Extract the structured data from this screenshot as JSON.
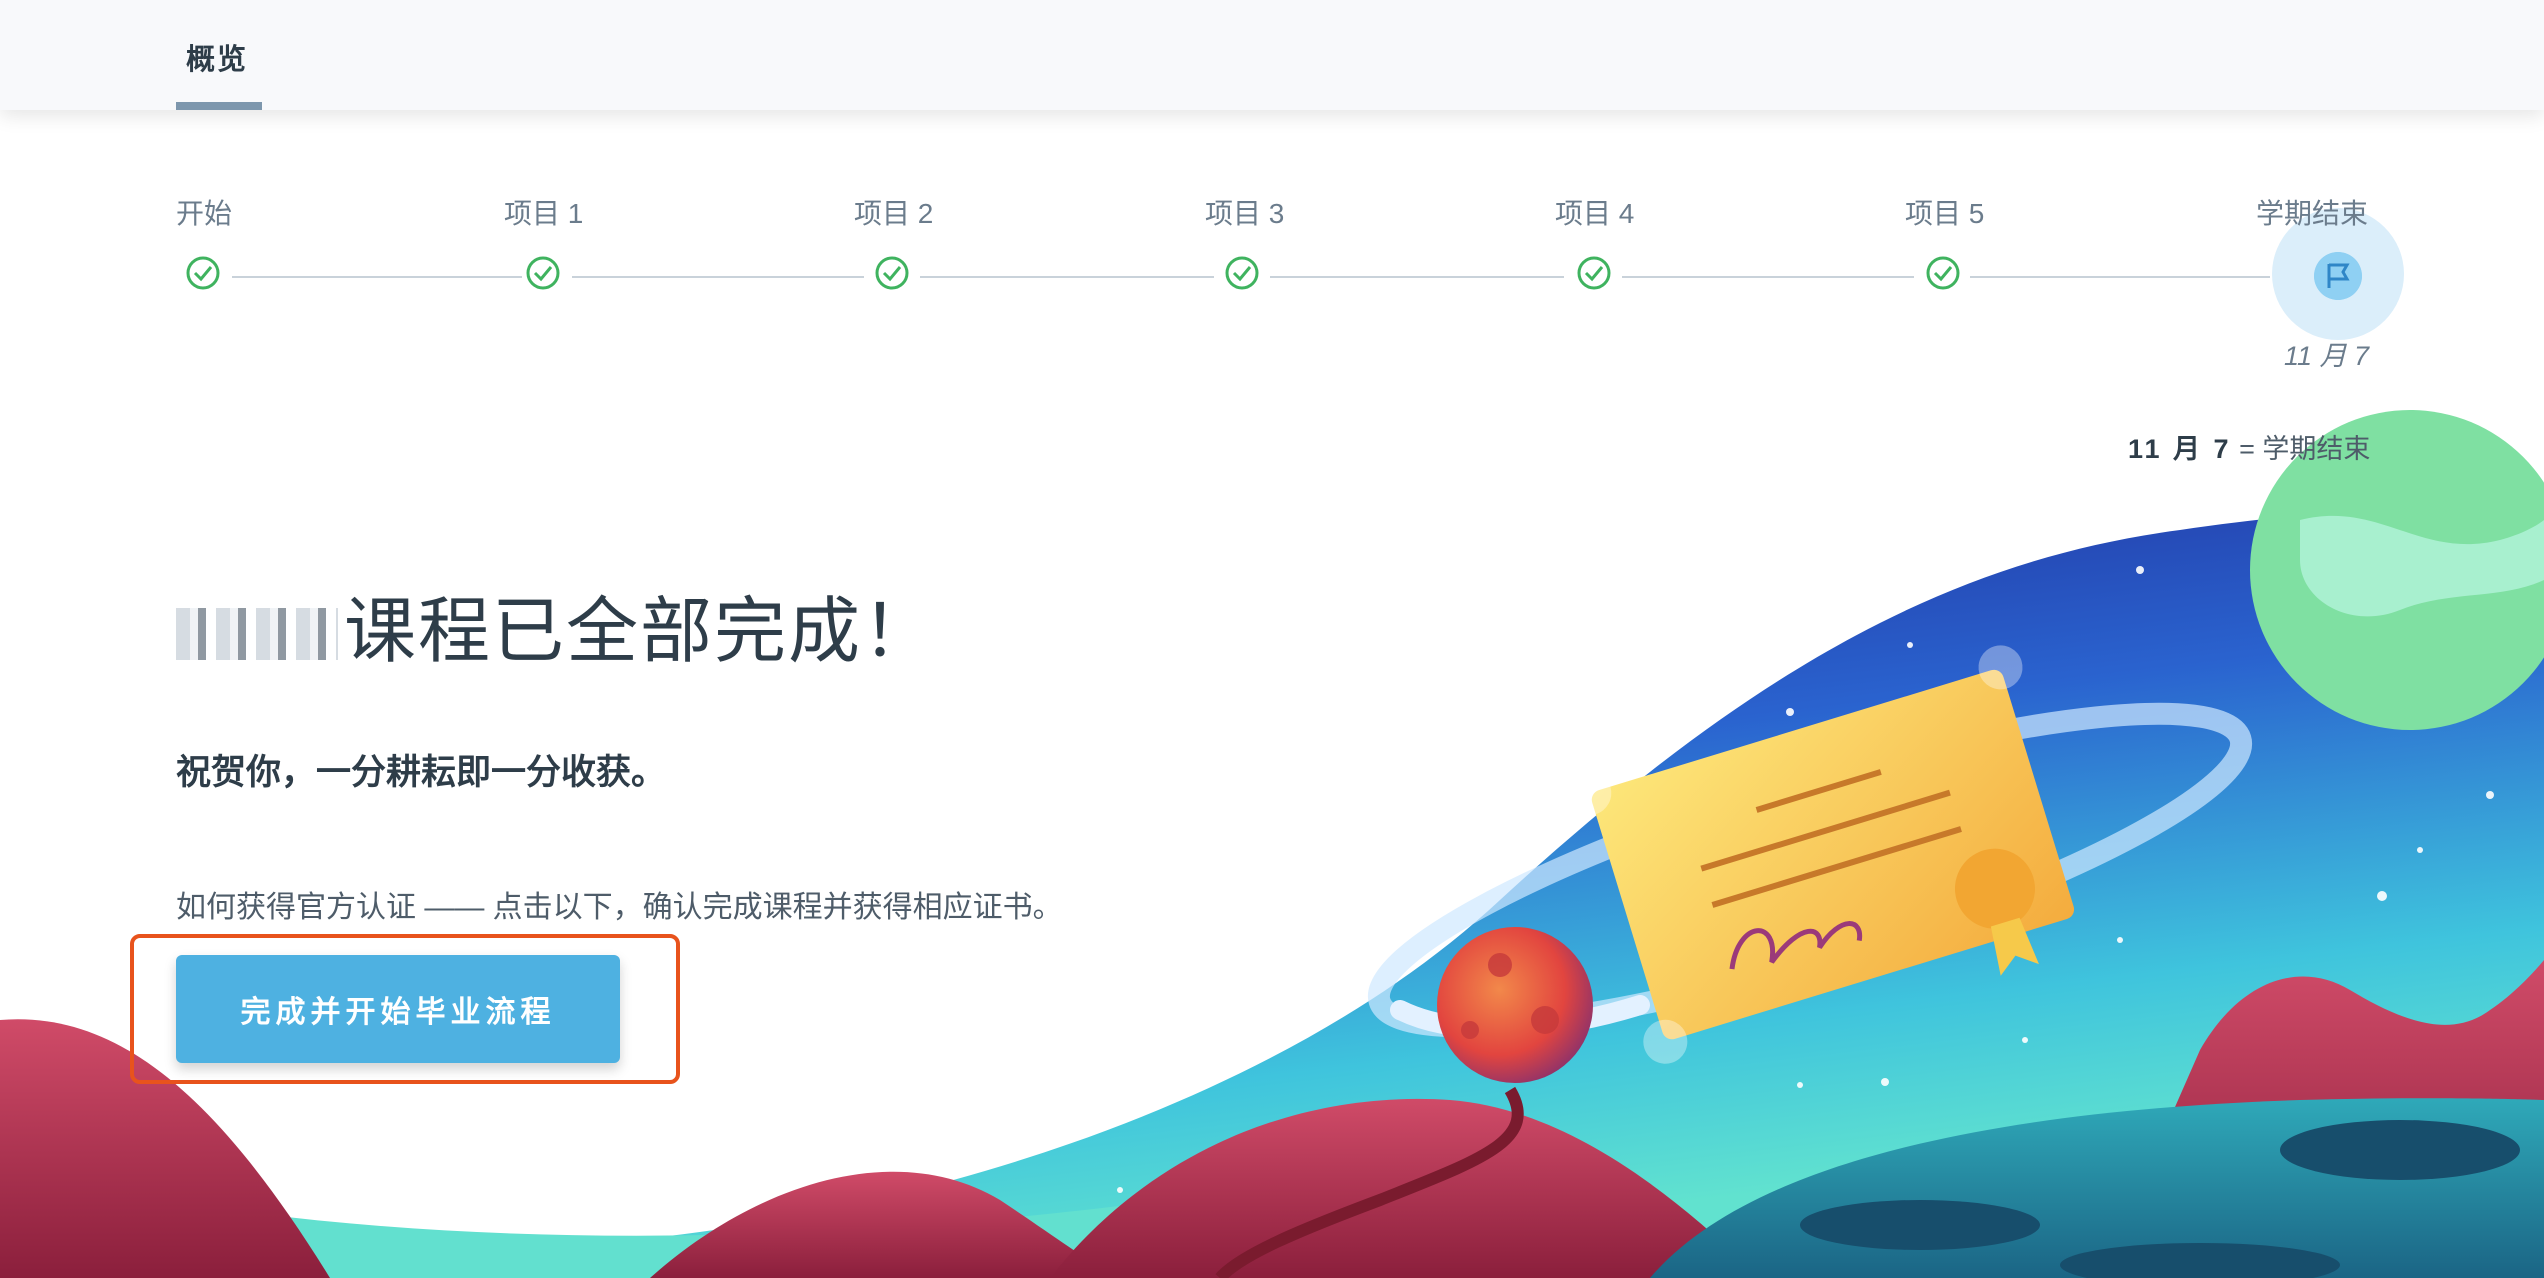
{
  "nav": {
    "tab_overview": "概览"
  },
  "timeline": {
    "steps": [
      {
        "label": "开始",
        "status": "complete"
      },
      {
        "label": "项目 1",
        "status": "complete"
      },
      {
        "label": "项目 2",
        "status": "complete"
      },
      {
        "label": "项目 3",
        "status": "complete"
      },
      {
        "label": "项目 4",
        "status": "complete"
      },
      {
        "label": "项目 5",
        "status": "complete"
      },
      {
        "label": "学期结束",
        "status": "end"
      }
    ],
    "end_date": "11 月 7",
    "legend_date": "11 月 7",
    "legend_text": "= 学期结束"
  },
  "main": {
    "headline": "课程已全部完成！",
    "congrats": "祝贺你，一分耕耘即一分收获。",
    "howto": "如何获得官方认证 —— 点击以下，确认完成课程并获得相应证书。",
    "cta_button": "完成并开始毕业流程"
  },
  "colors": {
    "accent_button": "#4eb1e1",
    "check_green": "#3fb35f",
    "highlight_border": "#e8531c",
    "tab_underline": "#7d97ad"
  }
}
